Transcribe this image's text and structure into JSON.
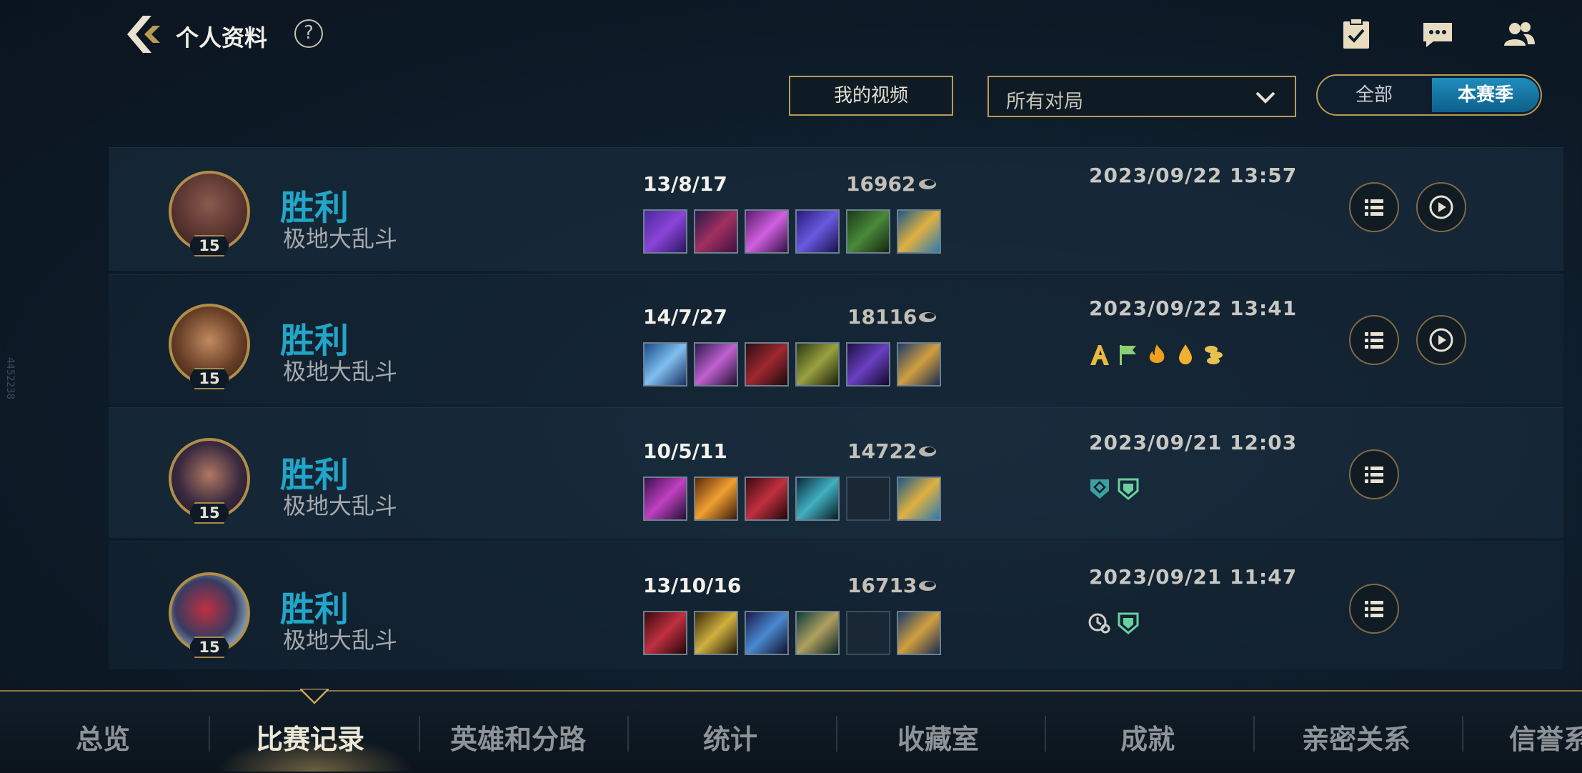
{
  "side_id": "4452238",
  "header": {
    "title": "个人资料",
    "help": "?"
  },
  "filters": {
    "my_videos": "我的视频",
    "match_filter": "所有对局",
    "toggle_all": "全部",
    "toggle_season": "本赛季"
  },
  "matches": [
    {
      "result": "胜利",
      "mode": "极地大乱斗",
      "level": "15",
      "kda": "13/8/17",
      "gold": "16962",
      "date": "2023/09/22 13:57",
      "badges": [],
      "has_replay": true
    },
    {
      "result": "胜利",
      "mode": "极地大乱斗",
      "level": "15",
      "kda": "14/7/27",
      "gold": "18116",
      "date": "2023/09/22 13:41",
      "badges": [
        "a-rank-icon",
        "flag-icon",
        "fire-icon",
        "drop-icon",
        "coins-icon"
      ],
      "has_replay": true
    },
    {
      "result": "胜利",
      "mode": "极地大乱斗",
      "level": "15",
      "kda": "10/5/11",
      "gold": "14722",
      "date": "2023/09/21 12:03",
      "badges": [
        "shield-diamond-icon",
        "shield-plus-icon"
      ],
      "has_replay": false
    },
    {
      "result": "胜利",
      "mode": "极地大乱斗",
      "level": "15",
      "kda": "13/10/16",
      "gold": "16713",
      "date": "2023/09/21 11:47",
      "badges": [
        "clock-link-icon",
        "shield-plus-icon"
      ],
      "has_replay": false
    }
  ],
  "tabs": [
    "总览",
    "比赛记录",
    "英雄和分路",
    "统计",
    "收藏室",
    "成就",
    "亲密关系",
    "信誉系"
  ],
  "active_tab": "比赛记录",
  "colors": {
    "win": "#21a6c9",
    "gold_border": "#b99a55",
    "accent_blue": "#1f8dbd"
  }
}
